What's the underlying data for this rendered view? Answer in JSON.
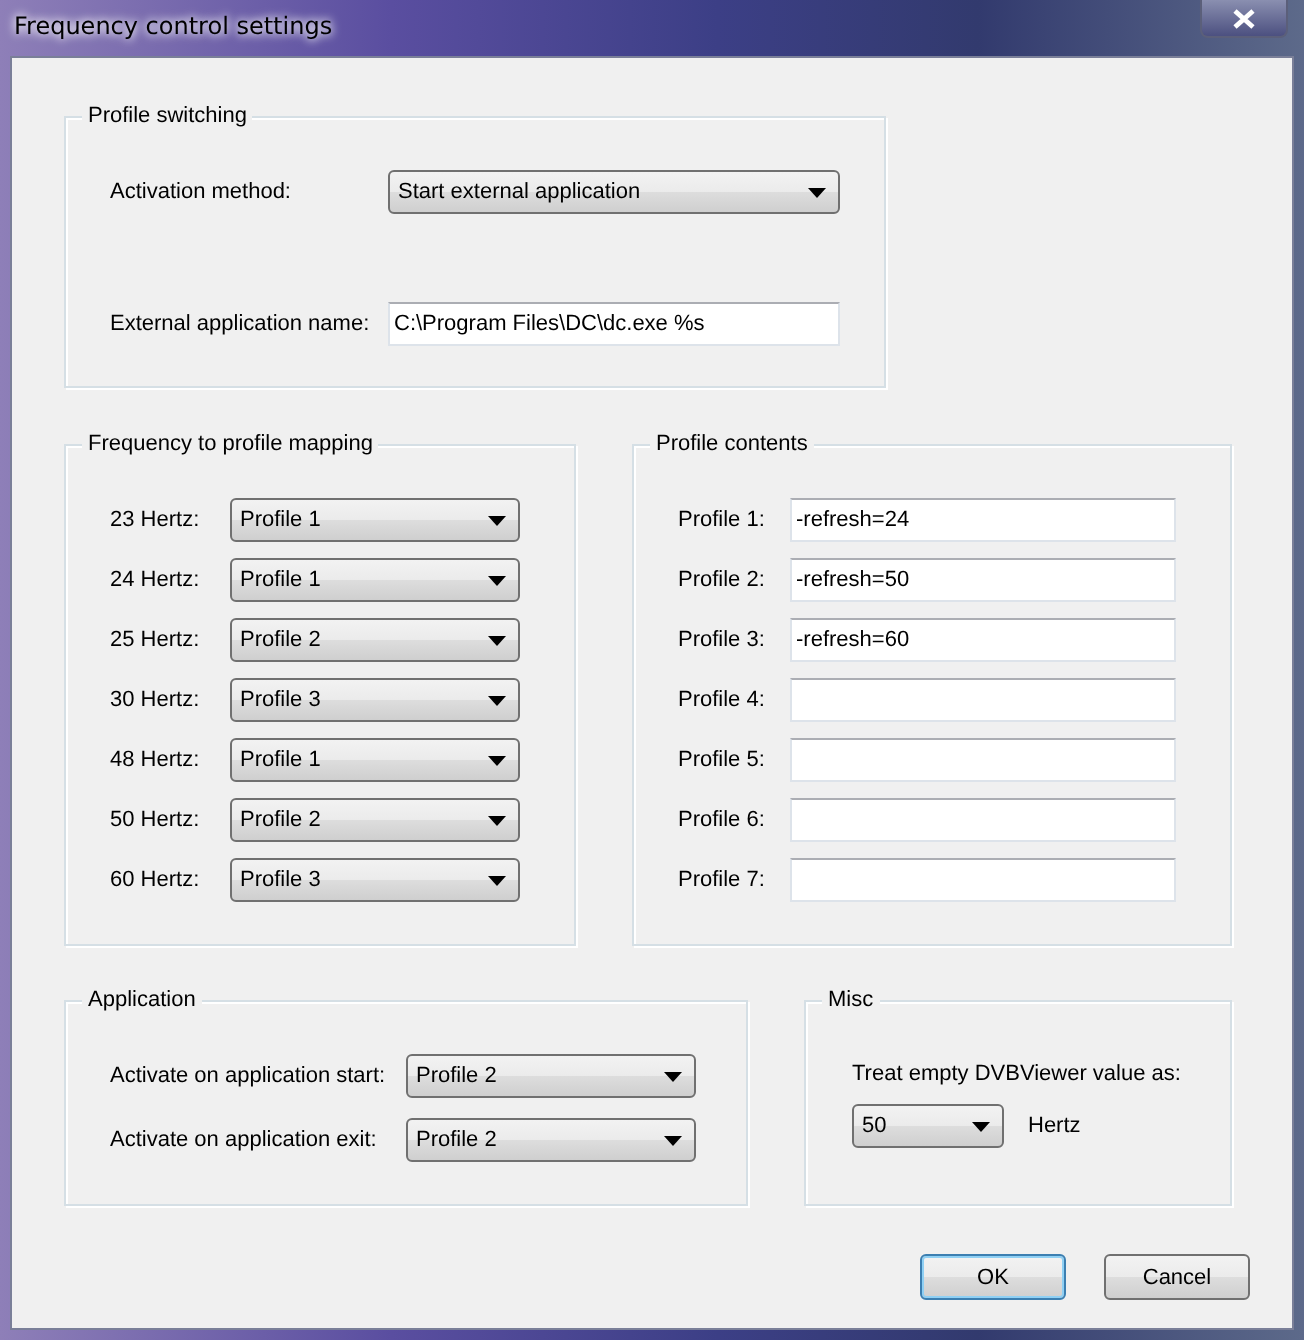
{
  "window": {
    "title": "Frequency control settings"
  },
  "profile_switching": {
    "title": "Profile switching",
    "activation_method": {
      "label": "Activation method:",
      "value": "Start external application"
    },
    "external_application_name": {
      "label": "External application name:",
      "value": "C:\\Program Files\\DC\\dc.exe %s"
    }
  },
  "frequency_mapping": {
    "title": "Frequency to profile mapping",
    "rows": [
      {
        "label": "23 Hertz:",
        "value": "Profile 1"
      },
      {
        "label": "24 Hertz:",
        "value": "Profile 1"
      },
      {
        "label": "25 Hertz:",
        "value": "Profile 2"
      },
      {
        "label": "30 Hertz:",
        "value": "Profile 3"
      },
      {
        "label": "48 Hertz:",
        "value": "Profile 1"
      },
      {
        "label": "50 Hertz:",
        "value": "Profile 2"
      },
      {
        "label": "60 Hertz:",
        "value": "Profile 3"
      }
    ]
  },
  "profile_contents": {
    "title": "Profile contents",
    "rows": [
      {
        "label": "Profile 1:",
        "value": "-refresh=24"
      },
      {
        "label": "Profile 2:",
        "value": "-refresh=50"
      },
      {
        "label": "Profile 3:",
        "value": "-refresh=60"
      },
      {
        "label": "Profile 4:"
      },
      {
        "label": "Profile 5:"
      },
      {
        "label": "Profile 6:"
      },
      {
        "label": "Profile 7:"
      }
    ]
  },
  "application": {
    "title": "Application",
    "rows": [
      {
        "label": "Activate on application start:",
        "value": "Profile 2"
      },
      {
        "label": "Activate on application exit:",
        "value": "Profile 2"
      }
    ]
  },
  "misc": {
    "title": "Misc",
    "text": "Treat empty DVBViewer value as:",
    "value": "50",
    "unit": "Hertz"
  },
  "buttons": [
    {
      "label": "OK",
      "default": true
    },
    {
      "label": "Cancel",
      "default": false
    }
  ]
}
